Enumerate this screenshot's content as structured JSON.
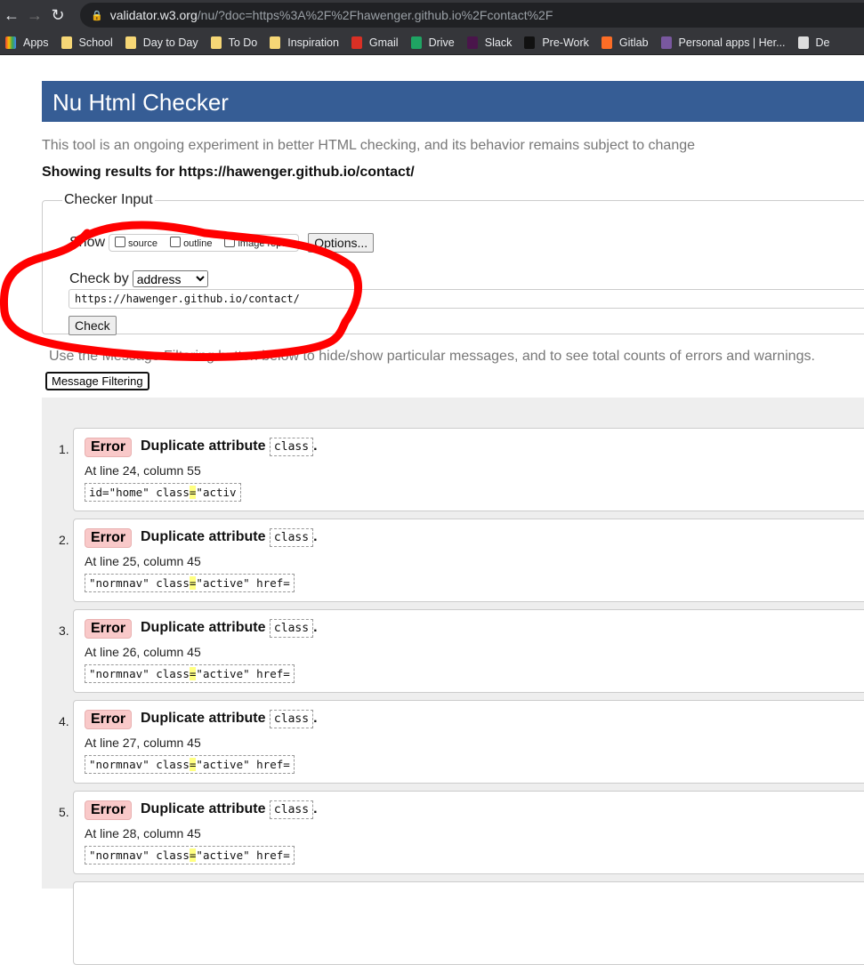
{
  "browser": {
    "url_host": "validator.w3.org",
    "url_rest": "/nu/?doc=https%3A%2F%2Fhawenger.github.io%2Fcontact%2F",
    "bookmarks": [
      {
        "label": "Apps",
        "icon": "apps-grid-icon"
      },
      {
        "label": "School",
        "icon": "folder-icon"
      },
      {
        "label": "Day to Day",
        "icon": "folder-icon"
      },
      {
        "label": "To Do",
        "icon": "folder-icon"
      },
      {
        "label": "Inspiration",
        "icon": "folder-icon"
      },
      {
        "label": "Gmail",
        "icon": "gmail-icon"
      },
      {
        "label": "Drive",
        "icon": "drive-icon"
      },
      {
        "label": "Slack",
        "icon": "slack-icon"
      },
      {
        "label": "Pre-Work",
        "icon": "book-icon"
      },
      {
        "label": "Gitlab",
        "icon": "gitlab-icon"
      },
      {
        "label": "Personal apps | Her...",
        "icon": "heroku-icon"
      },
      {
        "label": "De",
        "icon": "search-icon"
      }
    ]
  },
  "page": {
    "title": "Nu Html Checker",
    "intro": "This tool is an ongoing experiment in better HTML checking, and its behavior remains subject to change",
    "showing": "Showing results for https://hawenger.github.io/contact/",
    "checker": {
      "legend": "Checker Input",
      "show_label": "Show",
      "opt_source": "source",
      "opt_outline": "outline",
      "opt_image": "image report",
      "options_btn": "Options...",
      "check_by_label": "Check by",
      "check_by_value": "address",
      "url_value": "https://hawenger.github.io/contact/",
      "check_btn": "Check"
    },
    "filter_text": "Use the Message Filtering button below to hide/show particular messages, and to see total counts of errors and warnings.",
    "filter_btn": "Message Filtering",
    "messages": [
      {
        "n": "1.",
        "type": "Error",
        "text": "Duplicate attribute",
        "code": "class",
        "loc": "At line 24, column 55",
        "pre": "id=\"home\" class",
        "hl": "=",
        "post": "\"activ"
      },
      {
        "n": "2.",
        "type": "Error",
        "text": "Duplicate attribute",
        "code": "class",
        "loc": "At line 25, column 45",
        "pre": "\"normnav\" class",
        "hl": "=",
        "post": "\"active\" href="
      },
      {
        "n": "3.",
        "type": "Error",
        "text": "Duplicate attribute",
        "code": "class",
        "loc": "At line 26, column 45",
        "pre": "\"normnav\" class",
        "hl": "=",
        "post": "\"active\" href="
      },
      {
        "n": "4.",
        "type": "Error",
        "text": "Duplicate attribute",
        "code": "class",
        "loc": "At line 27, column 45",
        "pre": "\"normnav\" class",
        "hl": "=",
        "post": "\"active\" href="
      },
      {
        "n": "5.",
        "type": "Error",
        "text": "Duplicate attribute",
        "code": "class",
        "loc": "At line 28, column 45",
        "pre": "\"normnav\" class",
        "hl": "=",
        "post": "\"active\" href="
      }
    ]
  }
}
